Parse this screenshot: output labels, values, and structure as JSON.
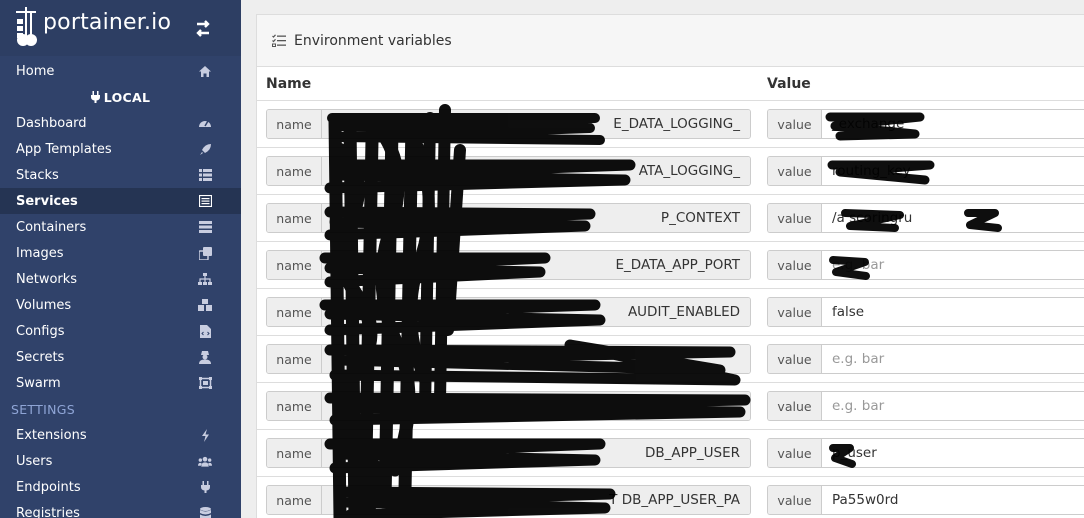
{
  "brand": {
    "name": "portainer.io"
  },
  "sidebar": {
    "items_top": [
      {
        "label": "Home",
        "icon": "home-icon"
      }
    ],
    "endpoint_label": "LOCAL",
    "items": [
      {
        "label": "Dashboard",
        "icon": "tachometer-icon"
      },
      {
        "label": "App Templates",
        "icon": "rocket-icon"
      },
      {
        "label": "Stacks",
        "icon": "th-list-icon"
      },
      {
        "label": "Services",
        "icon": "list-alt-icon",
        "active": true
      },
      {
        "label": "Containers",
        "icon": "server-icon"
      },
      {
        "label": "Images",
        "icon": "clone-icon"
      },
      {
        "label": "Networks",
        "icon": "sitemap-icon"
      },
      {
        "label": "Volumes",
        "icon": "cubes-icon"
      },
      {
        "label": "Configs",
        "icon": "file-code-icon"
      },
      {
        "label": "Secrets",
        "icon": "user-secret-icon"
      },
      {
        "label": "Swarm",
        "icon": "object-group-icon"
      }
    ],
    "settings_title": "SETTINGS",
    "settings_items": [
      {
        "label": "Extensions",
        "icon": "bolt-icon"
      },
      {
        "label": "Users",
        "icon": "users-icon"
      },
      {
        "label": "Endpoints",
        "icon": "plug-icon"
      },
      {
        "label": "Registries",
        "icon": "database-icon"
      }
    ]
  },
  "panel": {
    "title": "Environment variables",
    "col_name": "Name",
    "col_value": "Value",
    "name_addon": "name",
    "value_addon": "value",
    "value_placeholder": "e.g. bar",
    "rows": [
      {
        "name": "E_DATA_LOGGING_",
        "value": "_exchange"
      },
      {
        "name": "ATA_LOGGING_",
        "value": "routing_key"
      },
      {
        "name": "P_CONTEXT",
        "value": "/a scoringru"
      },
      {
        "name": "E_DATA_APP_PORT",
        "value": ""
      },
      {
        "name": "AUDIT_ENABLED",
        "value": "false"
      },
      {
        "name": "",
        "value": ""
      },
      {
        "name": "",
        "value": ""
      },
      {
        "name": "DB_APP_USER",
        "value": "p_user"
      },
      {
        "name": "T DB_APP_USER_PA",
        "value": "Pa55w0rd"
      }
    ]
  },
  "colors": {
    "sidebar_bg": "#30426a",
    "sidebar_active": "#253453",
    "settings_title": "#8fa5d6"
  }
}
